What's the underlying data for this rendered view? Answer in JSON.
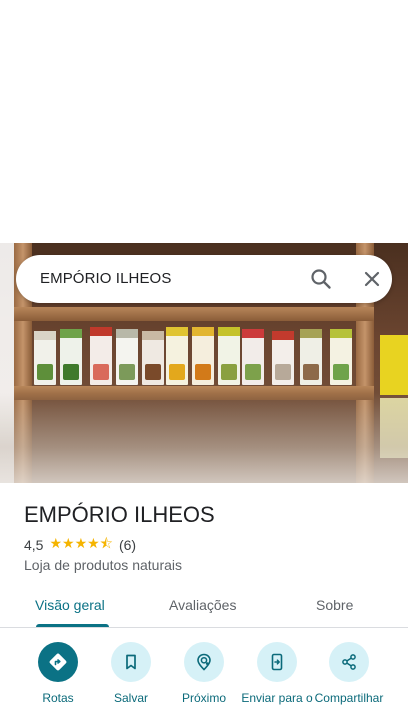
{
  "search": {
    "query": "EMPÓRIO ILHEOS",
    "search_icon": "search-icon",
    "close_icon": "close-icon"
  },
  "place": {
    "name": "EMPÓRIO ILHEOS",
    "rating": "4,5",
    "stars": "★★★★⯪",
    "review_count": "(6)",
    "category": "Loja de produtos naturais"
  },
  "tabs": [
    {
      "label": "Visão geral",
      "active": true
    },
    {
      "label": "Avaliações",
      "active": false
    },
    {
      "label": "Sobre",
      "active": false
    }
  ],
  "actions": [
    {
      "label": "Rotas",
      "icon": "directions-icon"
    },
    {
      "label": "Salvar",
      "icon": "bookmark-icon"
    },
    {
      "label": "Próximo",
      "icon": "nearby-icon"
    },
    {
      "label": "Enviar para o",
      "icon": "send-to-phone-icon"
    },
    {
      "label": "Compartilhar",
      "icon": "share-icon"
    }
  ],
  "colors": {
    "accent": "#0b7285",
    "action_bg": "#d6f1f7",
    "star": "#f5b400"
  }
}
